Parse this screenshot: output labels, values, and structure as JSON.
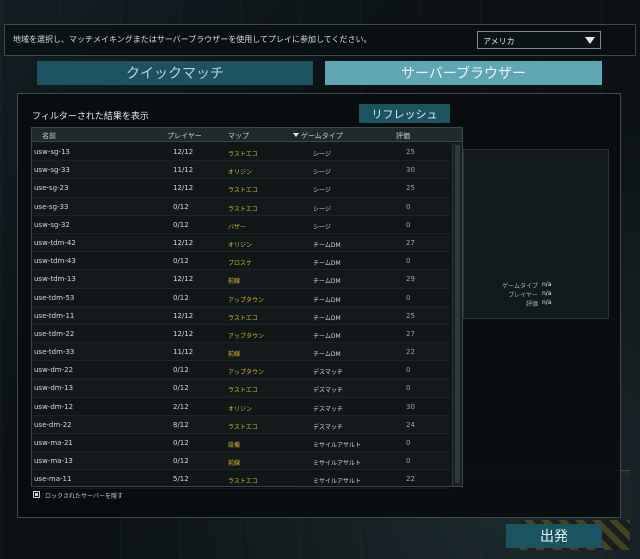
{
  "header": {
    "instruction": "地域を選択し、マッチメイキングまたはサーバーブラウザーを使用してプレイに参加してください。",
    "region_value": "アメリカ"
  },
  "tabs": [
    {
      "label": "クイックマッチ",
      "active": false
    },
    {
      "label": "サーバーブラウザー",
      "active": true
    }
  ],
  "panel": {
    "filter_label": "フィルターされた結果を表示",
    "refresh_label": "リフレッシュ"
  },
  "table": {
    "headers": {
      "name": "名前",
      "players": "プレイヤー",
      "map": "マップ",
      "type": "ゲームタイプ",
      "rating": "評価"
    },
    "sorted_by": "type",
    "rows": [
      {
        "name": "usw-sg-13",
        "players": "12/12",
        "map": "ラストエコ",
        "type": "シージ",
        "rating": "25"
      },
      {
        "name": "usw-sg-33",
        "players": "11/12",
        "map": "オリジン",
        "type": "シージ",
        "rating": "30"
      },
      {
        "name": "use-sg-23",
        "players": "12/12",
        "map": "ラストエコ",
        "type": "シージ",
        "rating": "25"
      },
      {
        "name": "use-sg-33",
        "players": "0/12",
        "map": "ラストエコ",
        "type": "シージ",
        "rating": "0"
      },
      {
        "name": "usw-sg-32",
        "players": "0/12",
        "map": "バザー",
        "type": "シージ",
        "rating": "0"
      },
      {
        "name": "usw-tdm-42",
        "players": "12/12",
        "map": "オリジン",
        "type": "チームDM",
        "rating": "27"
      },
      {
        "name": "usw-tdm-43",
        "players": "0/12",
        "map": "ブロスケ",
        "type": "チームDM",
        "rating": "0"
      },
      {
        "name": "usw-tdm-13",
        "players": "12/12",
        "map": "前線",
        "type": "チームDM",
        "rating": "29"
      },
      {
        "name": "use-tdm-53",
        "players": "0/12",
        "map": "アップタウン",
        "type": "チームDM",
        "rating": "0"
      },
      {
        "name": "use-tdm-11",
        "players": "12/12",
        "map": "ラストエコ",
        "type": "チームDM",
        "rating": "25"
      },
      {
        "name": "use-tdm-22",
        "players": "12/12",
        "map": "アップタウン",
        "type": "チームDM",
        "rating": "27"
      },
      {
        "name": "use-tdm-33",
        "players": "11/12",
        "map": "前線",
        "type": "チームDM",
        "rating": "22"
      },
      {
        "name": "usw-dm-22",
        "players": "0/12",
        "map": "アップタウン",
        "type": "デスマッチ",
        "rating": "0"
      },
      {
        "name": "usw-dm-13",
        "players": "0/12",
        "map": "ラストエコ",
        "type": "デスマッチ",
        "rating": "0"
      },
      {
        "name": "usw-dm-12",
        "players": "2/12",
        "map": "オリジン",
        "type": "デスマッチ",
        "rating": "30"
      },
      {
        "name": "use-dm-22",
        "players": "8/12",
        "map": "ラストエコ",
        "type": "デスマッチ",
        "rating": "24"
      },
      {
        "name": "usw-ma-21",
        "players": "0/12",
        "map": "設備",
        "type": "ミサイルアサルト",
        "rating": "0"
      },
      {
        "name": "usw-ma-13",
        "players": "0/12",
        "map": "前線",
        "type": "ミサイルアサルト",
        "rating": "0"
      },
      {
        "name": "use-ma-11",
        "players": "5/12",
        "map": "ラストエコ",
        "type": "ミサイルアサルト",
        "rating": "22"
      }
    ]
  },
  "details": {
    "type_label": "ゲームタイプ",
    "type_value": "n/a",
    "players_label": "プレイヤー",
    "players_value": "n/a",
    "rating_label": "評価",
    "rating_value": "n/a"
  },
  "lock_checkbox": {
    "label": "ロックされたサーバーを隠す",
    "checked": true
  },
  "launch_label": "出発",
  "colors": {
    "accent": "#1b5460",
    "accent_active": "#5fa7b4",
    "map_text": "#d8b62c"
  }
}
